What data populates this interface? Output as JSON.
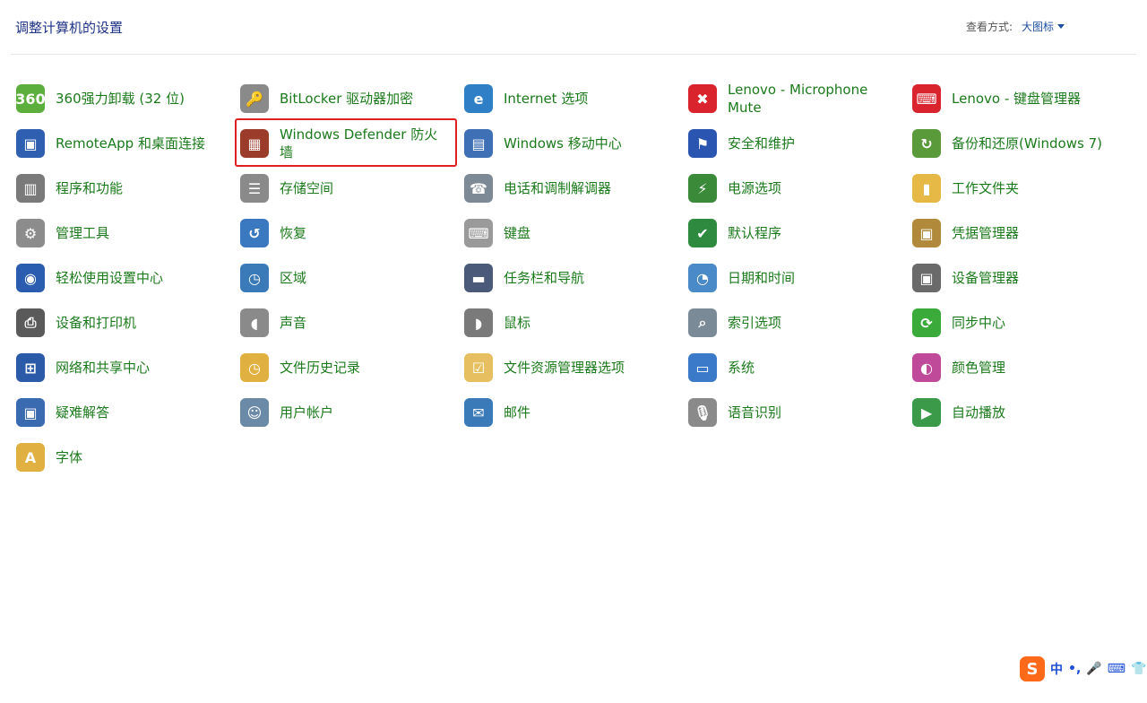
{
  "header": {
    "title": "调整计算机的设置",
    "view_label": "查看方式:",
    "view_value": "大图标"
  },
  "items": [
    {
      "label": "360强力卸载 (32 位)",
      "icon": "uninstall-icon",
      "glyph": "360",
      "color": "#5cae3d"
    },
    {
      "label": "BitLocker 驱动器加密",
      "icon": "bitlocker-key-icon",
      "glyph": "🔑",
      "color": "#8a8a8a"
    },
    {
      "label": "Internet 选项",
      "icon": "internet-options-icon",
      "glyph": "e",
      "color": "#2f7fc6"
    },
    {
      "label": "Lenovo - Microphone Mute",
      "icon": "microphone-mute-icon",
      "glyph": "✖",
      "color": "#d9232d"
    },
    {
      "label": "Lenovo - 键盘管理器",
      "icon": "keyboard-manager-icon",
      "glyph": "⌨",
      "color": "#d9232d"
    },
    {
      "label": "RemoteApp 和桌面连接",
      "icon": "remoteapp-icon",
      "glyph": "▣",
      "color": "#2e5fb0"
    },
    {
      "label": "Windows Defender 防火墙",
      "icon": "firewall-icon",
      "glyph": "▦",
      "color": "#9b3b2a"
    },
    {
      "label": "Windows 移动中心",
      "icon": "mobility-center-icon",
      "glyph": "▤",
      "color": "#3f6fb4"
    },
    {
      "label": "安全和维护",
      "icon": "security-flag-icon",
      "glyph": "⚑",
      "color": "#2a55b0"
    },
    {
      "label": "备份和还原(Windows 7)",
      "icon": "backup-restore-icon",
      "glyph": "↻",
      "color": "#5a9a3a"
    },
    {
      "label": "程序和功能",
      "icon": "programs-features-icon",
      "glyph": "▥",
      "color": "#7a7a7a"
    },
    {
      "label": "存储空间",
      "icon": "storage-spaces-icon",
      "glyph": "☰",
      "color": "#8a8a8a"
    },
    {
      "label": "电话和调制解调器",
      "icon": "phone-modem-icon",
      "glyph": "☎",
      "color": "#7d8a96"
    },
    {
      "label": "电源选项",
      "icon": "power-options-icon",
      "glyph": "⚡",
      "color": "#3a8a3a"
    },
    {
      "label": "工作文件夹",
      "icon": "work-folders-icon",
      "glyph": "▮",
      "color": "#e6b845"
    },
    {
      "label": "管理工具",
      "icon": "admin-tools-icon",
      "glyph": "⚙",
      "color": "#8c8c8c"
    },
    {
      "label": "恢复",
      "icon": "recovery-icon",
      "glyph": "↺",
      "color": "#3a78c0"
    },
    {
      "label": "键盘",
      "icon": "keyboard-icon",
      "glyph": "⌨",
      "color": "#9a9a9a"
    },
    {
      "label": "默认程序",
      "icon": "default-programs-icon",
      "glyph": "✔",
      "color": "#2e8a3e"
    },
    {
      "label": "凭据管理器",
      "icon": "credential-manager-icon",
      "glyph": "▣",
      "color": "#b08a3a"
    },
    {
      "label": "轻松使用设置中心",
      "icon": "ease-of-access-icon",
      "glyph": "◉",
      "color": "#2a5cb0"
    },
    {
      "label": "区域",
      "icon": "region-clock-icon",
      "glyph": "◷",
      "color": "#3a7ab8"
    },
    {
      "label": "任务栏和导航",
      "icon": "taskbar-icon",
      "glyph": "▬",
      "color": "#4a5a78"
    },
    {
      "label": "日期和时间",
      "icon": "date-time-icon",
      "glyph": "◔",
      "color": "#4a8ac8"
    },
    {
      "label": "设备管理器",
      "icon": "device-manager-icon",
      "glyph": "▣",
      "color": "#6a6a6a"
    },
    {
      "label": "设备和打印机",
      "icon": "devices-printers-icon",
      "glyph": "⎙",
      "color": "#5a5a5a"
    },
    {
      "label": "声音",
      "icon": "sound-speaker-icon",
      "glyph": "◖",
      "color": "#8a8a8a"
    },
    {
      "label": "鼠标",
      "icon": "mouse-icon",
      "glyph": "◗",
      "color": "#7a7a7a"
    },
    {
      "label": "索引选项",
      "icon": "indexing-options-icon",
      "glyph": "⌕",
      "color": "#7a8a96"
    },
    {
      "label": "同步中心",
      "icon": "sync-center-icon",
      "glyph": "⟳",
      "color": "#3aaa3a"
    },
    {
      "label": "网络和共享中心",
      "icon": "network-sharing-icon",
      "glyph": "⊞",
      "color": "#2a5aa8"
    },
    {
      "label": "文件历史记录",
      "icon": "file-history-icon",
      "glyph": "◷",
      "color": "#e0b040"
    },
    {
      "label": "文件资源管理器选项",
      "icon": "explorer-options-icon",
      "glyph": "☑",
      "color": "#e6c060"
    },
    {
      "label": "系统",
      "icon": "system-icon",
      "glyph": "▭",
      "color": "#3a7ac8"
    },
    {
      "label": "颜色管理",
      "icon": "color-management-icon",
      "glyph": "◐",
      "color": "#c04a9a"
    },
    {
      "label": "疑难解答",
      "icon": "troubleshooting-icon",
      "glyph": "▣",
      "color": "#3a6ab0"
    },
    {
      "label": "用户帐户",
      "icon": "user-accounts-icon",
      "glyph": "☺",
      "color": "#6a8aa8"
    },
    {
      "label": "邮件",
      "icon": "mail-icon",
      "glyph": "✉",
      "color": "#3a7ab8"
    },
    {
      "label": "语音识别",
      "icon": "speech-recognition-icon",
      "glyph": "🎙",
      "color": "#8a8a8a"
    },
    {
      "label": "自动播放",
      "icon": "autoplay-icon",
      "glyph": "▶",
      "color": "#3a9a4a"
    },
    {
      "label": "字体",
      "icon": "fonts-icon",
      "glyph": "A",
      "color": "#e0b040"
    }
  ],
  "highlight_index": 6,
  "ime": {
    "logo": "S",
    "lang": "中",
    "punct": "•,",
    "mic": "🎤",
    "keyboard": "⌨",
    "extra": "👕"
  }
}
